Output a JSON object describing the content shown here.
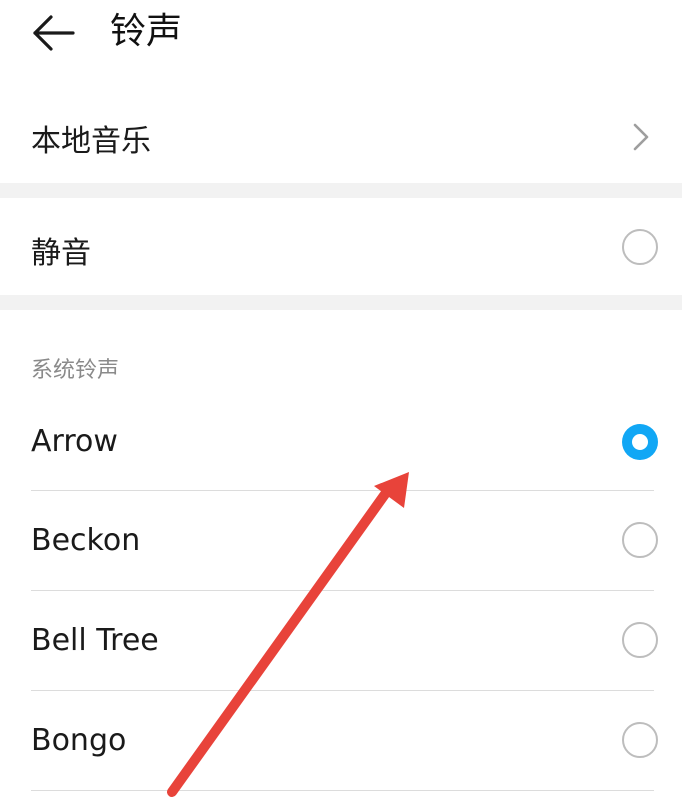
{
  "header": {
    "title": "铃声",
    "back_icon": "arrow-left-icon"
  },
  "local_music": {
    "label": "本地音乐",
    "icon": "chevron-right-icon"
  },
  "silent": {
    "label": "静音",
    "selected": false
  },
  "system_ringtones": {
    "section_title": "系统铃声",
    "items": [
      {
        "label": "Arrow",
        "selected": true
      },
      {
        "label": "Beckon",
        "selected": false
      },
      {
        "label": "Bell Tree",
        "selected": false
      },
      {
        "label": "Bongo",
        "selected": false
      }
    ]
  },
  "colors": {
    "accent": "#11a7f5",
    "annotation_arrow": "#e8433a",
    "section_gap": "#f2f2f2"
  }
}
